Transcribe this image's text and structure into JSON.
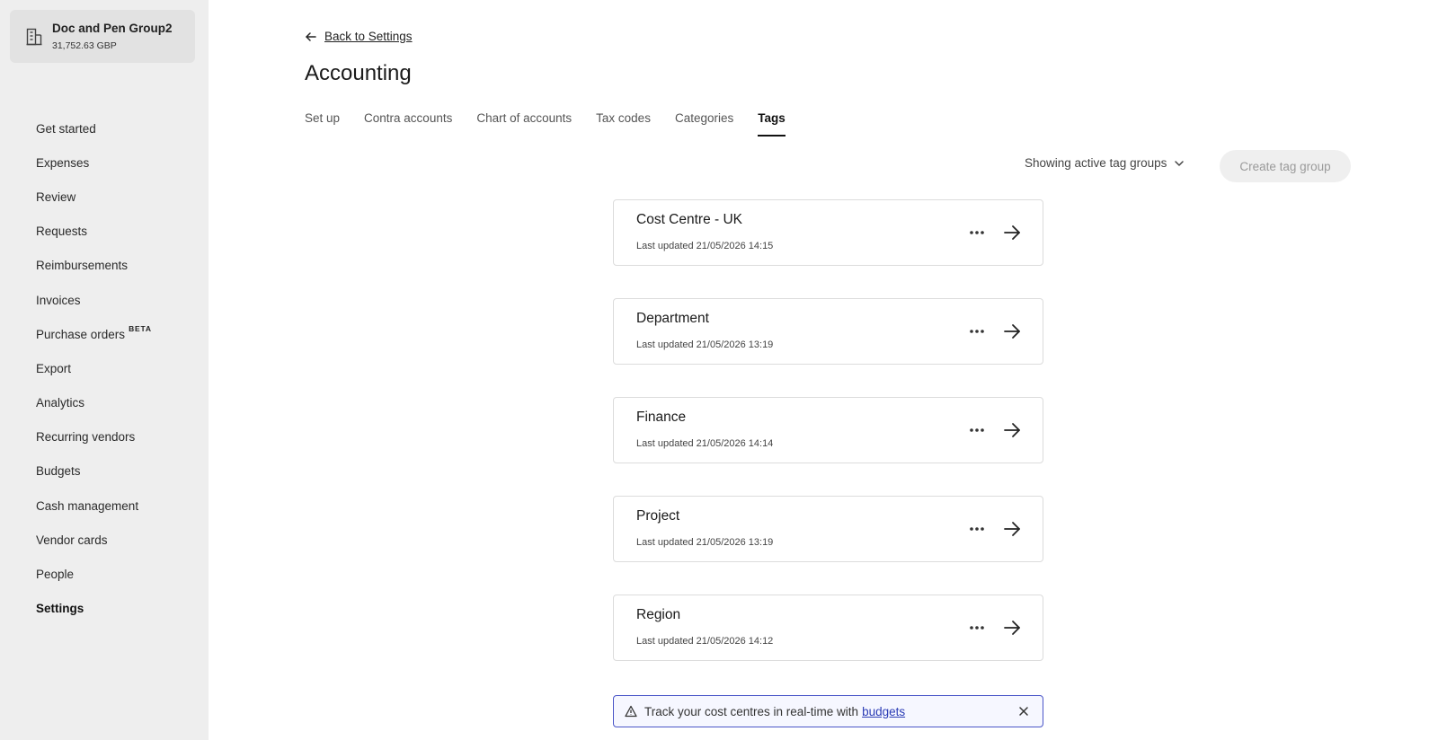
{
  "company": {
    "name": "Doc and Pen Group2",
    "balance": "31,752.63 GBP",
    "icon": "building-icon"
  },
  "sidebar": {
    "items": [
      {
        "label": "Get started"
      },
      {
        "label": "Expenses"
      },
      {
        "label": "Review"
      },
      {
        "label": "Requests"
      },
      {
        "label": "Reimbursements"
      },
      {
        "label": "Invoices"
      },
      {
        "label": "Purchase orders",
        "badge": "BETA"
      },
      {
        "label": "Export"
      },
      {
        "label": "Analytics"
      },
      {
        "label": "Recurring vendors"
      },
      {
        "label": "Budgets"
      },
      {
        "label": "Cash management"
      },
      {
        "label": "Vendor cards"
      },
      {
        "label": "People"
      },
      {
        "label": "Settings",
        "active": true
      }
    ]
  },
  "header": {
    "back_label": "Back to Settings",
    "title": "Accounting"
  },
  "tabs": [
    {
      "label": "Set up"
    },
    {
      "label": "Contra accounts"
    },
    {
      "label": "Chart of accounts"
    },
    {
      "label": "Tax codes"
    },
    {
      "label": "Categories"
    },
    {
      "label": "Tags",
      "active": true
    }
  ],
  "toolbar": {
    "filter_label": "Showing active tag groups",
    "create_label": "Create tag group"
  },
  "tag_groups": [
    {
      "name": "Cost Centre - UK",
      "updated": "Last updated 21/05/2026 14:15"
    },
    {
      "name": "Department",
      "updated": "Last updated 21/05/2026 13:19"
    },
    {
      "name": "Finance",
      "updated": "Last updated 21/05/2026 14:14"
    },
    {
      "name": "Project",
      "updated": "Last updated 21/05/2026 13:19"
    },
    {
      "name": "Region",
      "updated": "Last updated 21/05/2026 14:12"
    }
  ],
  "banner": {
    "text": "Track your cost centres in real-time with",
    "link": "budgets",
    "accent": "#4a56c8"
  }
}
